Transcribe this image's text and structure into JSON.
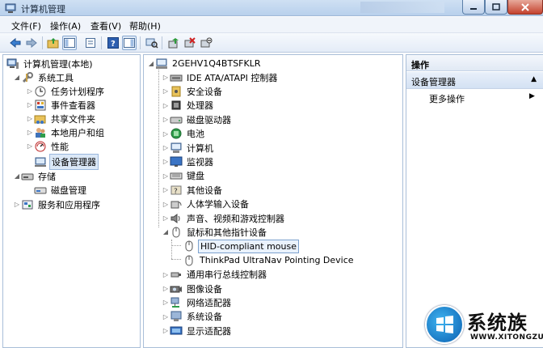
{
  "window": {
    "title": "计算机管理"
  },
  "menu": [
    "文件(F)",
    "操作(A)",
    "查看(V)",
    "帮助(H)"
  ],
  "left_tree": {
    "root": "计算机管理(本地)",
    "system_tools": "系统工具",
    "task_scheduler": "任务计划程序",
    "event_viewer": "事件查看器",
    "shared_folders": "共享文件夹",
    "local_users": "本地用户和组",
    "performance": "性能",
    "device_manager": "设备管理器",
    "storage": "存储",
    "disk_management": "磁盘管理",
    "services_apps": "服务和应用程序"
  },
  "device_tree": {
    "computer": "2GEHV1Q4BTSFKLR",
    "categories": [
      "IDE ATA/ATAPI 控制器",
      "安全设备",
      "处理器",
      "磁盘驱动器",
      "电池",
      "计算机",
      "监视器",
      "键盘",
      "其他设备",
      "人体学输入设备",
      "声音、视频和游戏控制器",
      "鼠标和其他指针设备"
    ],
    "mouse_children": [
      "HID-compliant mouse",
      "ThinkPad UltraNav Pointing Device"
    ],
    "categories_after": [
      "通用串行总线控制器",
      "图像设备",
      "网络适配器",
      "系统设备",
      "显示适配器"
    ]
  },
  "actions": {
    "header": "操作",
    "section": "设备管理器",
    "more": "更多操作"
  },
  "watermark": {
    "brand": "系统族",
    "url": "WWW.XITONGZU.COM"
  }
}
